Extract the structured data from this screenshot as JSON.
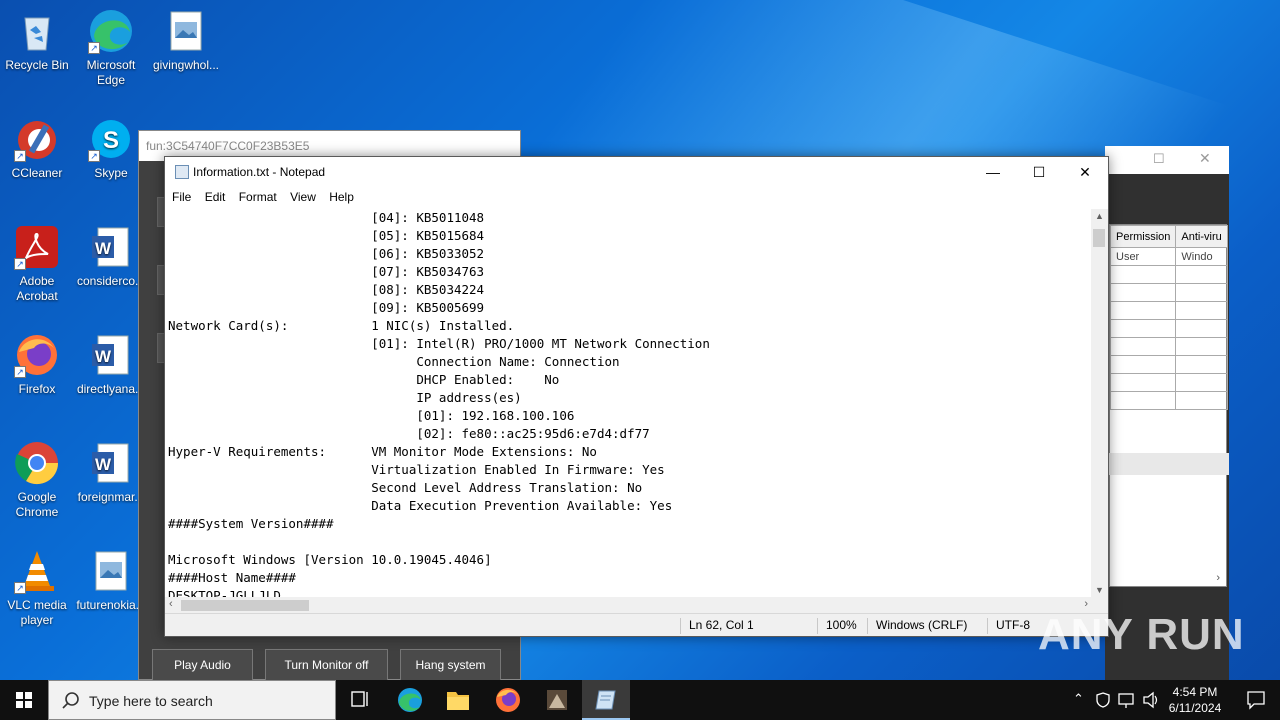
{
  "desktop": {
    "icons": [
      {
        "label": "Recycle Bin"
      },
      {
        "label": "Microsoft Edge"
      },
      {
        "label": "givingwhol..."
      },
      {
        "label": "CCleaner"
      },
      {
        "label": "Skype"
      },
      {
        "label": "Adobe Acrobat"
      },
      {
        "label": "considerco..."
      },
      {
        "label": "Firefox"
      },
      {
        "label": "directlyana..."
      },
      {
        "label": "Google Chrome"
      },
      {
        "label": "foreignmar..."
      },
      {
        "label": "VLC media player"
      },
      {
        "label": "futurenokia..."
      }
    ]
  },
  "bg_window": {
    "title": "fun:3C54740F7CC0F23B53E5",
    "buttons": {
      "play_audio": "Play Audio",
      "turn_monitor_off": "Turn Monitor off",
      "hang_system": "Hang system"
    }
  },
  "right_window": {
    "headers": [
      "Permission",
      "Anti-viru"
    ],
    "row1": [
      "User",
      "Windo"
    ]
  },
  "notepad": {
    "title": "Information.txt - Notepad",
    "menu": {
      "file": "File",
      "edit": "Edit",
      "format": "Format",
      "view": "View",
      "help": "Help"
    },
    "lines": [
      "                           [04]: KB5011048",
      "                           [05]: KB5015684",
      "                           [06]: KB5033052",
      "                           [07]: KB5034763",
      "                           [08]: KB5034224",
      "                           [09]: KB5005699",
      "Network Card(s):           1 NIC(s) Installed.",
      "                           [01]: Intel(R) PRO/1000 MT Network Connection",
      "                                 Connection Name: Connection",
      "                                 DHCP Enabled:    No",
      "                                 IP address(es)",
      "                                 [01]: 192.168.100.106",
      "                                 [02]: fe80::ac25:95d6:e7d4:df77",
      "Hyper-V Requirements:      VM Monitor Mode Extensions: No",
      "                           Virtualization Enabled In Firmware: Yes",
      "                           Second Level Address Translation: No",
      "                           Data Execution Prevention Available: Yes",
      "####System Version####",
      "",
      "Microsoft Windows [Version 10.0.19045.4046]",
      "####Host Name####",
      "DESKTOP-JGLLJLD"
    ],
    "status": {
      "position": "Ln 62, Col 1",
      "zoom": "100%",
      "line_ending": "Windows (CRLF)",
      "encoding": "UTF-8"
    }
  },
  "taskbar": {
    "search_placeholder": "Type here to search",
    "time": "4:54 PM",
    "date": "6/11/2024"
  },
  "watermark": "ANY RUN"
}
